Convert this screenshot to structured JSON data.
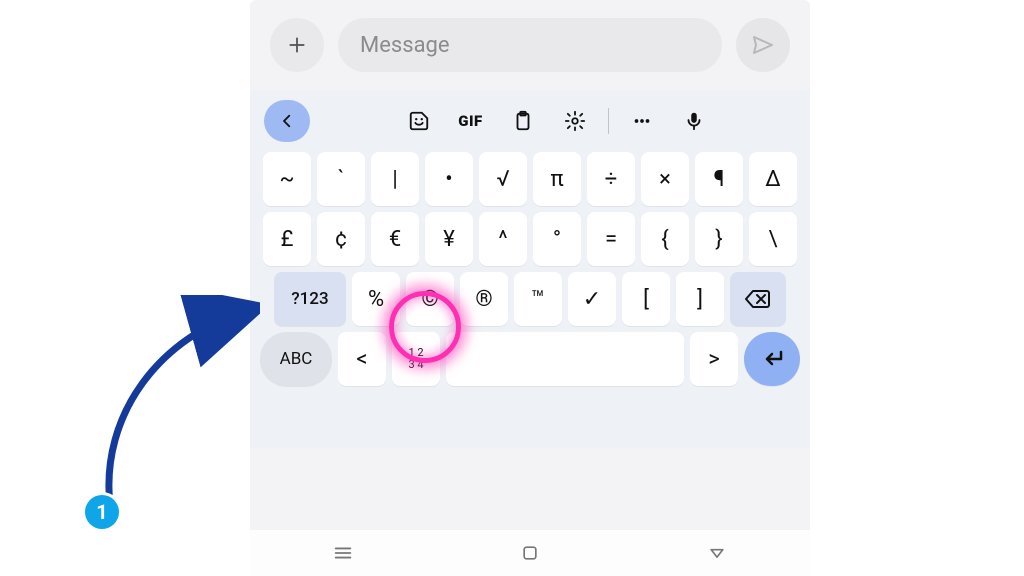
{
  "message": {
    "placeholder": "Message"
  },
  "toolbar": {
    "gif": "GIF"
  },
  "rows": {
    "r1": [
      "~",
      "`",
      "|",
      "•",
      "√",
      "π",
      "÷",
      "×",
      "¶",
      "Δ"
    ],
    "r2": [
      "£",
      "¢",
      "€",
      "¥",
      "^",
      "°",
      "=",
      "{",
      "}",
      "\\"
    ],
    "r3_more": "?123",
    "r3": [
      "%",
      "©",
      "®",
      "™",
      "✓",
      "[",
      "]"
    ],
    "r4_abc": "ABC",
    "r4_lt": "<",
    "r4_num_top": "1 2",
    "r4_num_bot": "3 4",
    "r4_gt": ">"
  },
  "badge": "1"
}
